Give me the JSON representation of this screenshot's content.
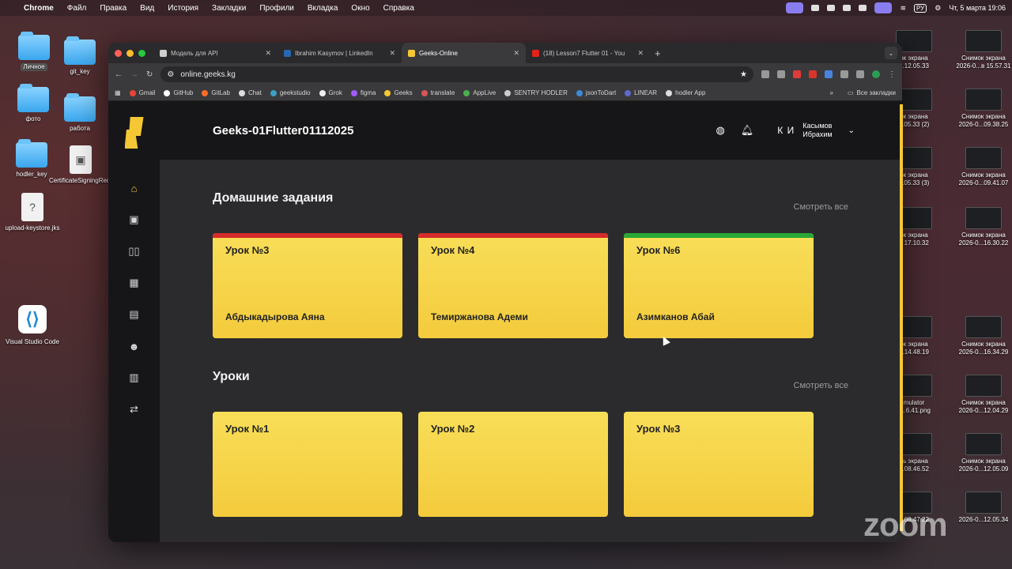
{
  "menubar": {
    "app": "Chrome",
    "items": [
      "Файл",
      "Правка",
      "Вид",
      "История",
      "Закладки",
      "Профили",
      "Вкладка",
      "Окно",
      "Справка"
    ],
    "lang": "РУ",
    "datetime": "Чт, 5 марта  19:06"
  },
  "desktop_left": [
    {
      "label": "Личное",
      "type": "folder",
      "selected": true
    },
    {
      "label": "git_key",
      "type": "folder"
    },
    {
      "label": "фото",
      "type": "folder"
    },
    {
      "label": "работа",
      "type": "folder"
    },
    {
      "label": "hodler_key",
      "type": "folder"
    },
    {
      "label": "CertificateSigningRequest...Request",
      "type": "file"
    },
    {
      "label": "upload-keystore.jks",
      "type": "file"
    },
    {
      "label": "Visual Studio Code",
      "type": "app"
    }
  ],
  "desktop_right": [
    {
      "l1": "ок экрана",
      "l2": "...12.05.33"
    },
    {
      "l1": "Снимок экрана",
      "l2": "2026-0...в 15.57.31"
    },
    {
      "l1": "ок экрана",
      "l2": "...05.33 (2)"
    },
    {
      "l1": "Снимок экрана",
      "l2": "2026-0...09.38.25"
    },
    {
      "l1": "ок экрана",
      "l2": "...05.33 (3)"
    },
    {
      "l1": "Снимок экрана",
      "l2": "2026-0...09.41.07"
    },
    {
      "l1": "ок экрана",
      "l2": "в 17.10.32"
    },
    {
      "l1": "Снимок экрана",
      "l2": "2026-0...16.30.22"
    },
    {
      "l1": "ок экрана",
      "l2": "...14.48.19"
    },
    {
      "l1": "Снимок экрана",
      "l2": "2026-0...16.34.29"
    },
    {
      "l1": "mulator",
      "l2": "s...6.41.png"
    },
    {
      "l1": "Снимок экрана",
      "l2": "2026-0...12.04.29"
    },
    {
      "l1": "сь экрана",
      "l2": "...08.46.52"
    },
    {
      "l1": "Снимок экрана",
      "l2": "2026-0...12.05.09"
    },
    {
      "l1": "",
      "l2": "...08.47.22"
    },
    {
      "l1": "",
      "l2": "2026-0...12.05.34"
    }
  ],
  "browser": {
    "tabs": [
      {
        "title": "Модель для API",
        "color": "#cfcfcf",
        "active": false
      },
      {
        "title": "Ibrahim Kasymov | LinkedIn",
        "color": "#2867b2",
        "active": false
      },
      {
        "title": "Geeks-Online",
        "color": "#f6c735",
        "active": true
      },
      {
        "title": "(18) Lesson7 Flutter 01 - You",
        "color": "#e62117",
        "active": false
      }
    ],
    "url": "online.geeks.kg",
    "bookmarks": [
      "Gmail",
      "GitHub",
      "GitLab",
      "Chat",
      "geekstudio",
      "Grok",
      "figma",
      "Geeks",
      "translate",
      "AppLive",
      "SENTRY HODLER",
      "jsonToDart",
      "LINEAR",
      "hodler App"
    ],
    "all_bookmarks": "Все закладки"
  },
  "app": {
    "course": "Geeks-01Flutter01112025",
    "user_initials": "К И",
    "user_name_1": "Касымов",
    "user_name_2": "Ибрахим",
    "homework": {
      "title": "Домашние задания",
      "see_all": "Смотреть все",
      "cards": [
        {
          "title": "Урок №3",
          "student": "Абдыкадырова Аяна",
          "status_color": "#d62b2b"
        },
        {
          "title": "Урок №4",
          "student": "Темиржанова Адеми",
          "status_color": "#d62b2b"
        },
        {
          "title": "Урок №6",
          "student": "Азимканов Абай",
          "status_color": "#2aa836"
        }
      ]
    },
    "lessons": {
      "title": "Уроки",
      "see_all": "Смотреть все",
      "cards": [
        {
          "title": "Урок №1"
        },
        {
          "title": "Урок №2"
        },
        {
          "title": "Урок №3"
        }
      ]
    }
  },
  "zoom_watermark": "zoom"
}
